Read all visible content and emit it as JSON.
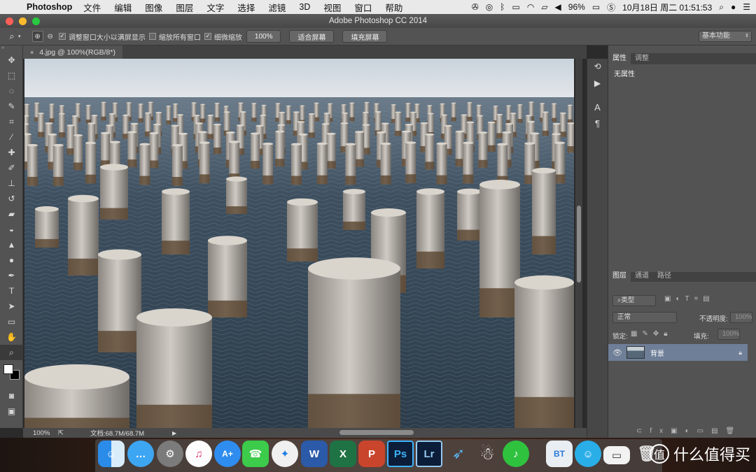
{
  "menubar": {
    "app_name": "Photoshop",
    "items": [
      "文件",
      "编辑",
      "图像",
      "图层",
      "文字",
      "选择",
      "滤镜",
      "3D",
      "视图",
      "窗口",
      "帮助"
    ],
    "battery": "96%",
    "datetime": "10月18日 周二  01:51:53"
  },
  "window": {
    "title": "Adobe Photoshop CC 2014"
  },
  "options_bar": {
    "resize_windows_label": "调整窗口大小以满屏显示",
    "zoom_all_label": "缩放所有窗口",
    "scrubby_zoom_label": "细微缩放",
    "btn_100": "100%",
    "btn_fit": "适合屏幕",
    "btn_fill": "填充屏幕",
    "workspace": "基本功能"
  },
  "document": {
    "tab_label": "4.jpg @ 100%(RGB/8*)"
  },
  "status": {
    "zoom": "100%",
    "doc_info": "文档:68.7M/68.7M"
  },
  "properties_panel": {
    "tab_properties": "属性",
    "tab_adjustments": "调整",
    "content": "无属性"
  },
  "layers_panel": {
    "tabs": [
      "图层",
      "通道",
      "路径"
    ],
    "filter_kind": "类型",
    "blend_mode": "正常",
    "opacity_label": "不透明度:",
    "opacity_value": "100%",
    "lock_label": "锁定:",
    "fill_label": "填充:",
    "fill_value": "100%",
    "layer_name": "背景"
  },
  "dock": {
    "items": [
      "finder",
      "messages",
      "system-preferences",
      "itunes",
      "instruments",
      "facetime",
      "safari",
      "word",
      "excel",
      "powerpoint",
      "photoshop",
      "lightroom",
      "feather",
      "qq",
      "music",
      "bt",
      "finder-face",
      "scanner",
      "trash"
    ]
  },
  "watermark": "什么值得买"
}
